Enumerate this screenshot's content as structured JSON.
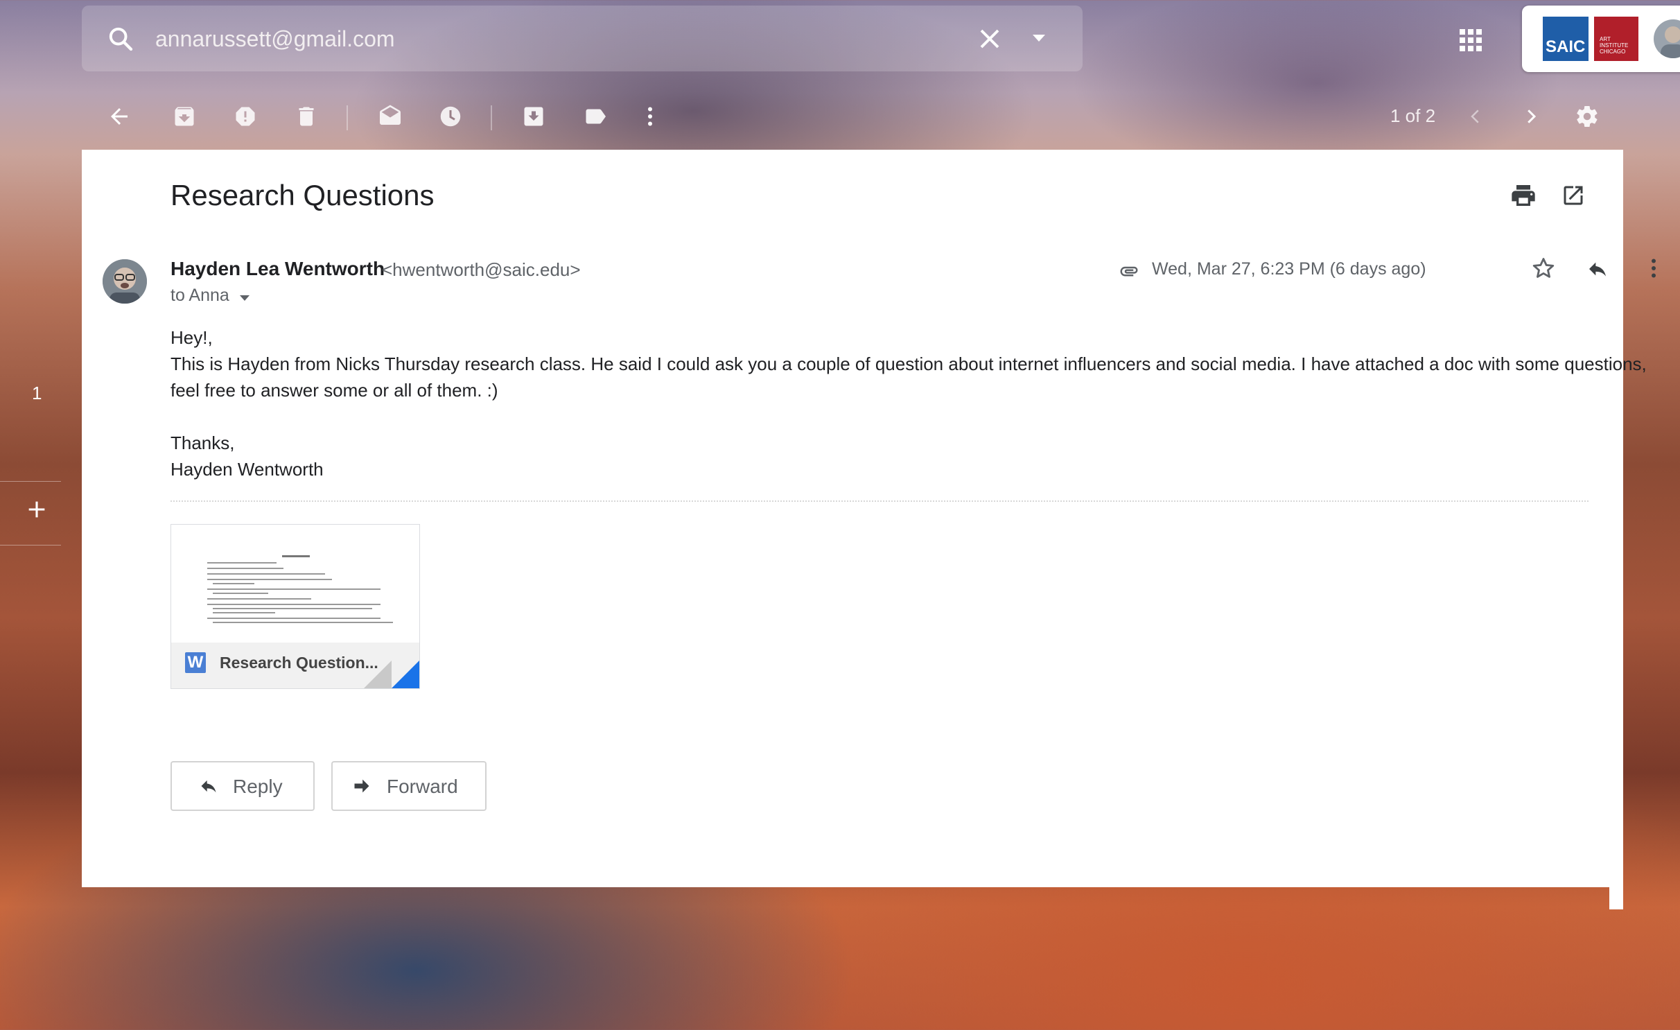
{
  "search": {
    "query": "annarussett@gmail.com"
  },
  "account": {
    "logo_text": "SAIC",
    "partner_logo_text": "ART INSTITUTE CHICAGO"
  },
  "pager": {
    "text": "1 of 2"
  },
  "left_rail": {
    "count": "1"
  },
  "email": {
    "subject": "Research Questions",
    "sender_name": "Hayden Lea Wentworth",
    "sender_email": "<hwentworth@saic.edu>",
    "to": "to Anna",
    "date": "Wed, Mar 27, 6:23 PM (6 days ago)",
    "body": {
      "greeting": "Hey!,",
      "paragraph": "This is Hayden from Nicks Thursday research class. He said I could ask you a couple of question about internet influencers and social media. I have attached a doc with some questions, feel free to answer some or all of them. :)",
      "closing": "Thanks,",
      "signature": "Hayden Wentworth"
    },
    "attachment": {
      "name": "Research Question...",
      "type_letter": "W"
    }
  },
  "actions": {
    "reply": "Reply",
    "forward": "Forward"
  },
  "colors": {
    "accent": "#1a73e8",
    "doc_icon": "#4a7fd4",
    "text": "#202124",
    "muted": "#5f6368"
  }
}
